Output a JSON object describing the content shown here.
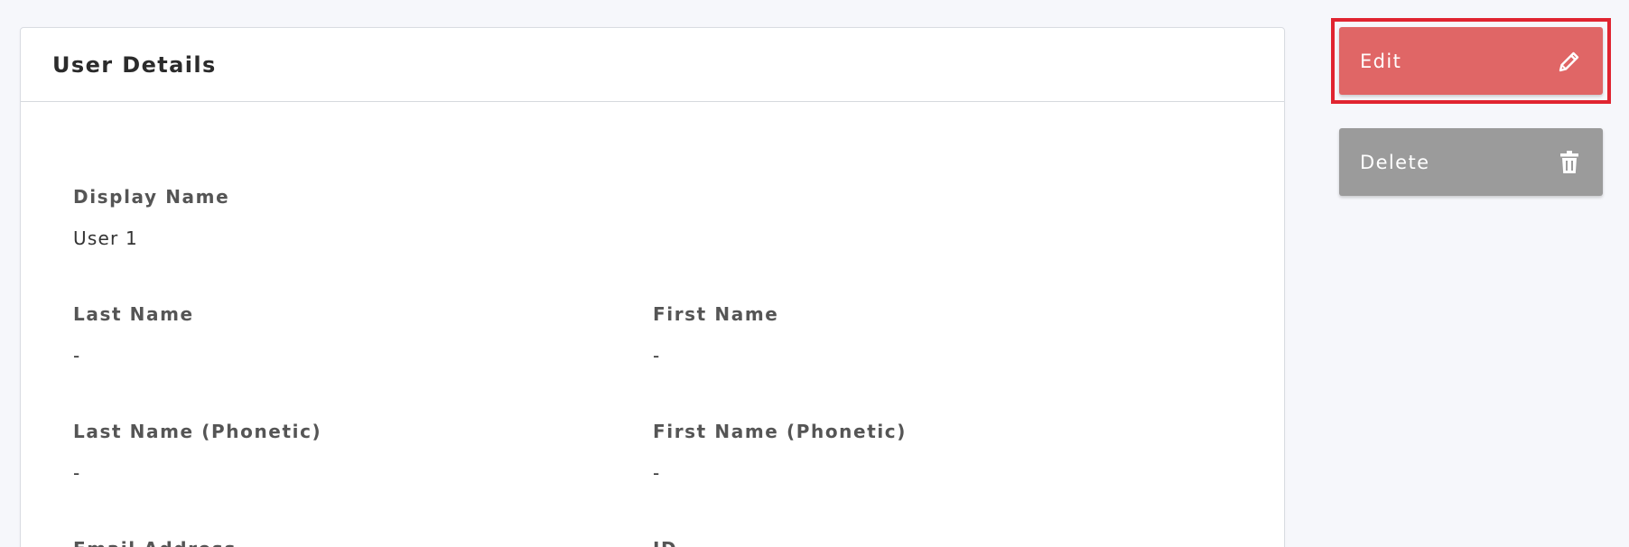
{
  "card": {
    "title": "User Details",
    "fields": {
      "display_name": {
        "label": "Display Name",
        "value": "User 1"
      },
      "last_name": {
        "label": "Last Name",
        "value": "-"
      },
      "first_name": {
        "label": "First Name",
        "value": "-"
      },
      "last_name_phonetic": {
        "label": "Last Name (Phonetic)",
        "value": "-"
      },
      "first_name_phonetic": {
        "label": "First Name (Phonetic)",
        "value": "-"
      },
      "email_address": {
        "label": "Email Address"
      },
      "id": {
        "label": "ID"
      }
    }
  },
  "actions": {
    "edit": {
      "label": "Edit",
      "icon": "pencil-icon",
      "color": "#e06666"
    },
    "delete": {
      "label": "Delete",
      "icon": "trash-icon",
      "color": "#9b9b9b"
    }
  },
  "highlight": {
    "color": "#e02430"
  }
}
